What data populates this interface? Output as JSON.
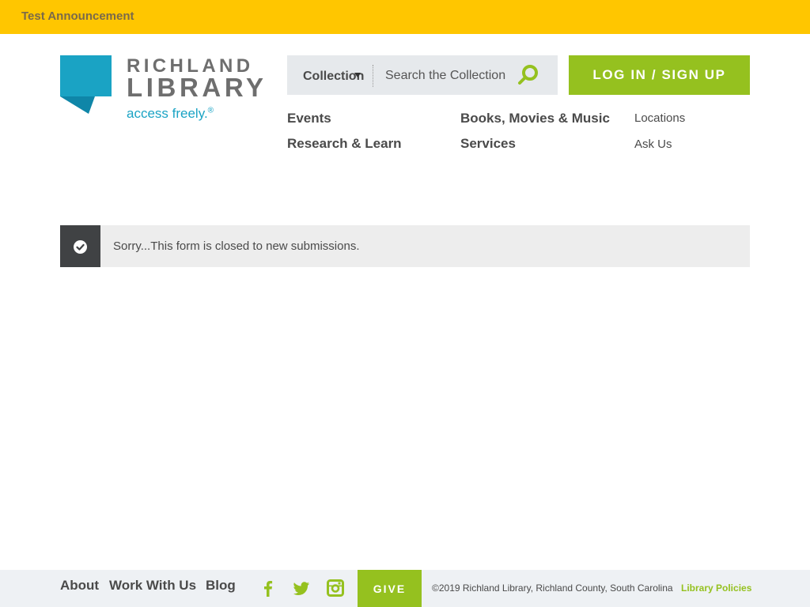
{
  "announcement": {
    "text": "Test Announcement"
  },
  "logo": {
    "line1": "RICHLAND",
    "line2": "LIBRARY",
    "tagline": "access freely.",
    "registered": "®",
    "brand_blue": "#1aa3c4"
  },
  "search": {
    "scope_label": "Collection",
    "placeholder": "Search the Collection",
    "icon": "search-icon"
  },
  "login": {
    "label": "LOG IN / SIGN UP"
  },
  "nav": {
    "primary": [
      "Events",
      "Research & Learn",
      "Books, Movies & Music",
      "Services"
    ],
    "utility": [
      "Locations",
      "Ask Us"
    ]
  },
  "notice": {
    "icon": "check-circle-icon",
    "message": "Sorry...This form is closed to new submissions."
  },
  "footer": {
    "links": [
      "About",
      "Work With Us",
      "Blog"
    ],
    "social_icons": [
      "facebook-icon",
      "twitter-icon",
      "instagram-icon"
    ],
    "give_label": "GIVE",
    "copyright": "©2019 Richland Library, Richland County, South Carolina",
    "policies_label": "Library Policies"
  },
  "colors": {
    "announcement_bg": "#ffc600",
    "accent_green": "#95c11f",
    "dark_gray": "#404244"
  }
}
